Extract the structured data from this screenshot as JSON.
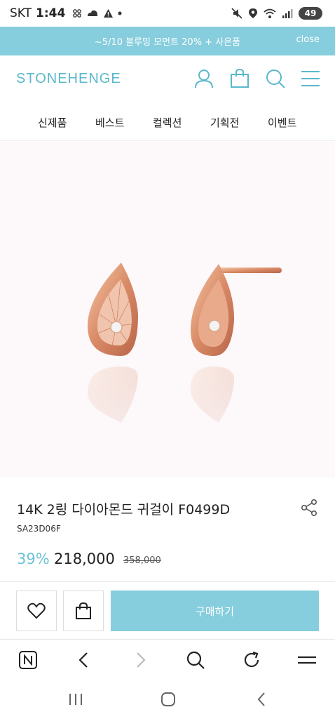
{
  "status_bar": {
    "carrier": "SKT",
    "time": "1:44",
    "battery": "49"
  },
  "banner": {
    "text": "~5/10 블루밍 모먼트 20% + 사은품",
    "close_label": "close"
  },
  "header": {
    "logo": "STONEHENGE"
  },
  "nav": {
    "items": [
      "신제품",
      "베스트",
      "컬렉션",
      "기획전",
      "이벤트"
    ]
  },
  "product": {
    "name": "14K 2링 다이아몬드 귀걸이 F0499D",
    "code": "SA23D06F",
    "discount": "39%",
    "price": "218,000",
    "original_price": "358,000"
  },
  "actions": {
    "buy_label": "구매하기"
  },
  "colors": {
    "accent": "#86cddd",
    "logo": "#5ab8cc",
    "discount": "#6fc3d6"
  }
}
